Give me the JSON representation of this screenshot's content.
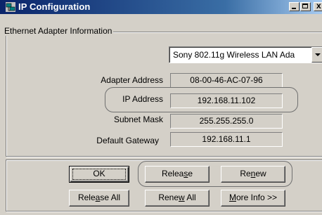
{
  "window": {
    "title": "IP Configuration",
    "minimize_icon": "minimize-icon",
    "maximize_icon": "maximize-icon",
    "close_icon": "close-icon",
    "app_icon": "network-icon"
  },
  "adapter_group": {
    "label": "Ethernet  Adapter Information",
    "adapter_select": {
      "selected": "Sony 802.11g Wireless LAN Ada"
    },
    "fields": [
      {
        "label": "Adapter Address",
        "value": "08-00-46-AC-07-96"
      },
      {
        "label": "IP Address",
        "value": "192.168.11.102"
      },
      {
        "label": "Subnet Mask",
        "value": "255.255.255.0"
      },
      {
        "label": "Default Gateway",
        "value": "192.168.11.1"
      }
    ]
  },
  "buttons": {
    "ok": {
      "label": "OK"
    },
    "release": {
      "pre": "Relea",
      "ul": "s",
      "post": "e"
    },
    "renew": {
      "pre": "Re",
      "ul": "n",
      "post": "ew"
    },
    "release_all": {
      "pre": "Rele",
      "ul": "a",
      "post": "se All"
    },
    "renew_all": {
      "pre": "Rene",
      "ul": "w",
      "post": " All"
    },
    "more_info": {
      "pre": "",
      "ul": "M",
      "post": "ore Info >>"
    }
  },
  "colors": {
    "titlebar_start": "#0a246a",
    "titlebar_end": "#a6caf0",
    "face": "#d4d0c8"
  }
}
